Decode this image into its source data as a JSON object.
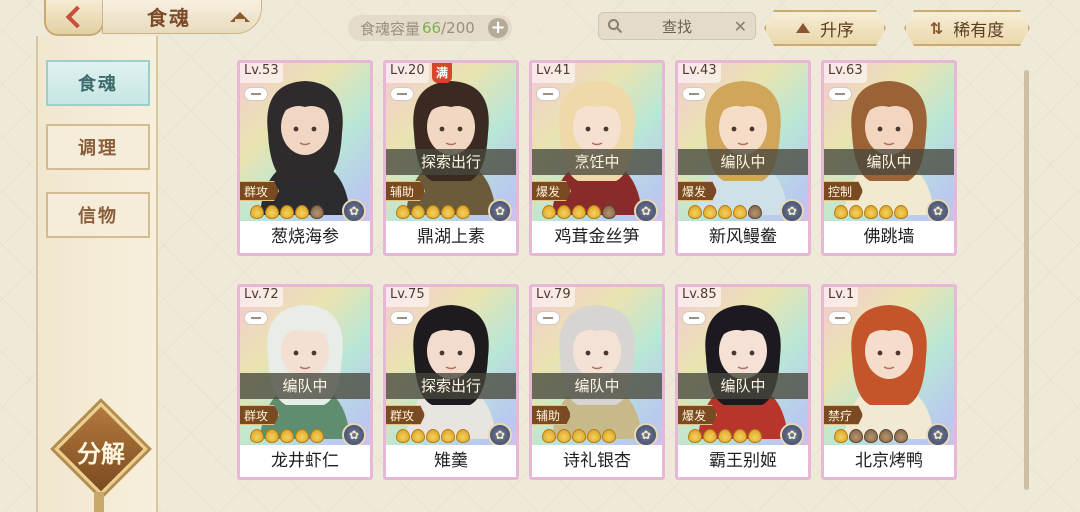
{
  "header": {
    "title": "食魂",
    "capacity_label": "食魂容量",
    "capacity_current": "66",
    "capacity_total": "/200",
    "search_label": "查找",
    "sort_ascending": "升序",
    "sort_rarity": "稀有度"
  },
  "sidebar": {
    "items": [
      {
        "label": "食魂"
      },
      {
        "label": "调理"
      },
      {
        "label": "信物"
      }
    ],
    "decompose": "分解"
  },
  "cards": [
    {
      "level": "Lv.53",
      "status": "",
      "role": "群攻",
      "stars": 4,
      "name": "葱烧海参",
      "hair": "#2f2a2c",
      "skin": "#f0d6c3",
      "coat": "#2c2c30"
    },
    {
      "level": "Lv.20",
      "full": "满",
      "status": "探索出行",
      "role": "辅助",
      "stars": 5,
      "name": "鼎湖上素",
      "hair": "#3a2a22",
      "skin": "#f2d8c2",
      "coat": "#6b5b3a"
    },
    {
      "level": "Lv.41",
      "status": "烹饪中",
      "role": "爆发",
      "stars": 4,
      "name": "鸡茸金丝笋",
      "hair": "#efd9a8",
      "skin": "#f6e0cf",
      "coat": "#8a2b2b"
    },
    {
      "level": "Lv.43",
      "status": "编队中",
      "role": "爆发",
      "stars": 4,
      "name": "新风鳗鲞",
      "hair": "#cfa65a",
      "skin": "#f5ddc8",
      "coat": "#cfe0e8"
    },
    {
      "level": "Lv.63",
      "status": "编队中",
      "role": "控制",
      "stars": 5,
      "name": "佛跳墙",
      "hair": "#9a6236",
      "skin": "#f3d6c0",
      "coat": "#f2ead0"
    },
    {
      "level": "Lv.72",
      "status": "编队中",
      "role": "群攻",
      "stars": 5,
      "name": "龙井虾仁",
      "hair": "#e8ede8",
      "skin": "#f4e0d2",
      "coat": "#5e8d6f"
    },
    {
      "level": "Lv.75",
      "status": "探索出行",
      "role": "群攻",
      "stars": 5,
      "name": "雉羹",
      "hair": "#1e1a1e",
      "skin": "#f3dccd",
      "coat": "#e8e4e0"
    },
    {
      "level": "Lv.79",
      "status": "编队中",
      "role": "辅助",
      "stars": 5,
      "name": "诗礼银杏",
      "hair": "#d8d4d2",
      "skin": "#f5e2d6",
      "coat": "#c7b98a"
    },
    {
      "level": "Lv.85",
      "status": "编队中",
      "role": "爆发",
      "stars": 5,
      "name": "霸王别姬",
      "hair": "#1c1a20",
      "skin": "#f6e1d6",
      "coat": "#b8352c"
    },
    {
      "level": "Lv.1",
      "status": "",
      "role": "禁疗",
      "stars": 1,
      "name": "北京烤鸭",
      "hair": "#c4542a",
      "skin": "#f5dccb",
      "coat": "#f0ead4"
    }
  ]
}
